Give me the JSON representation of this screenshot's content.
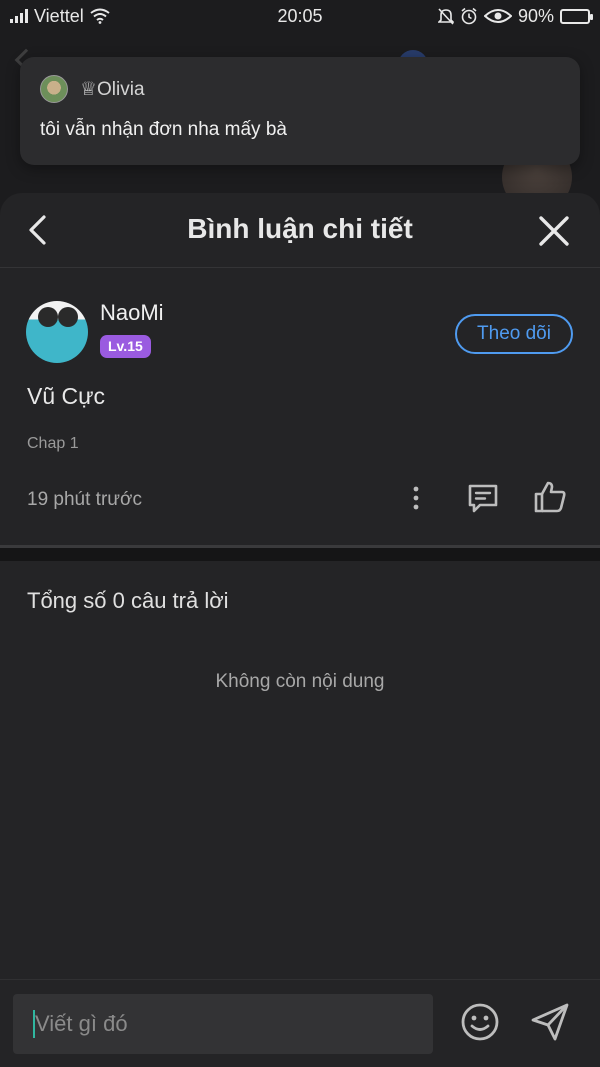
{
  "status_bar": {
    "carrier": "Viettel",
    "time": "20:05",
    "battery": "90%",
    "battery_level": 0.9
  },
  "background": {
    "name": "♕Olivia"
  },
  "notification": {
    "sender": "♕Olivia",
    "message": "tôi vẫn nhận đơn nha mấy bà"
  },
  "sheet": {
    "title": "Bình luận chi tiết"
  },
  "comment": {
    "user_name": "NaoMi",
    "level": "Lv.15",
    "follow_label": "Theo dõi",
    "text": "Vũ Cực",
    "chapter": "Chap 1",
    "time": "19 phút trước"
  },
  "replies": {
    "count_label": "Tổng số 0 câu trả lời",
    "empty_label": "Không còn nội dung"
  },
  "composer": {
    "placeholder": "Viết gì đó"
  },
  "colors": {
    "accent": "#4f9bf0",
    "level_badge": "#9a5be0",
    "caret": "#30b7a0"
  }
}
